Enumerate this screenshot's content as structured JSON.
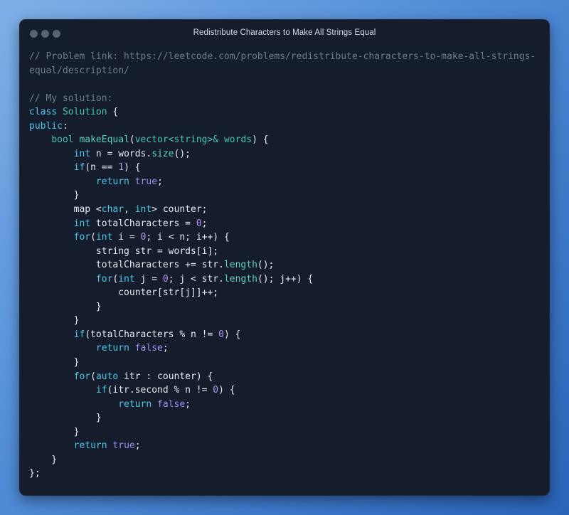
{
  "window": {
    "title": "Redistribute Characters to Make All Strings Equal"
  },
  "code_lines": [
    [
      {
        "t": "// Problem link: https://leetcode.com/problems/redistribute-characters-to-make-all-strings-",
        "c": "com"
      }
    ],
    [
      {
        "t": "equal/description/",
        "c": "com"
      }
    ],
    [],
    [
      {
        "t": "// My solution:",
        "c": "com"
      }
    ],
    [
      {
        "t": "class",
        "c": "kw"
      },
      {
        "t": " ",
        "c": "pl"
      },
      {
        "t": "Solution",
        "c": "ty"
      },
      {
        "t": " {",
        "c": "pl"
      }
    ],
    [
      {
        "t": "public",
        "c": "kw"
      },
      {
        "t": ":",
        "c": "pl"
      }
    ],
    [
      {
        "t": "    ",
        "c": "pl"
      },
      {
        "t": "bool",
        "c": "ty"
      },
      {
        "t": " ",
        "c": "pl"
      },
      {
        "t": "makeEqual",
        "c": "fn"
      },
      {
        "t": "(",
        "c": "pl"
      },
      {
        "t": "vector<string>& words",
        "c": "ty"
      },
      {
        "t": ") {",
        "c": "pl"
      }
    ],
    [
      {
        "t": "        ",
        "c": "pl"
      },
      {
        "t": "int",
        "c": "kw"
      },
      {
        "t": " n = words.",
        "c": "pl"
      },
      {
        "t": "size",
        "c": "fn"
      },
      {
        "t": "();",
        "c": "pl"
      }
    ],
    [
      {
        "t": "        ",
        "c": "pl"
      },
      {
        "t": "if",
        "c": "kw"
      },
      {
        "t": "(n == ",
        "c": "pl"
      },
      {
        "t": "1",
        "c": "num"
      },
      {
        "t": ") {",
        "c": "pl"
      }
    ],
    [
      {
        "t": "            ",
        "c": "pl"
      },
      {
        "t": "return",
        "c": "kw"
      },
      {
        "t": " ",
        "c": "pl"
      },
      {
        "t": "true",
        "c": "lit"
      },
      {
        "t": ";",
        "c": "pl"
      }
    ],
    [
      {
        "t": "        }",
        "c": "pl"
      }
    ],
    [
      {
        "t": "        map <",
        "c": "pl"
      },
      {
        "t": "char",
        "c": "kw"
      },
      {
        "t": ", ",
        "c": "pl"
      },
      {
        "t": "int",
        "c": "kw"
      },
      {
        "t": "> counter;",
        "c": "pl"
      }
    ],
    [
      {
        "t": "        ",
        "c": "pl"
      },
      {
        "t": "int",
        "c": "kw"
      },
      {
        "t": " totalCharacters = ",
        "c": "pl"
      },
      {
        "t": "0",
        "c": "num"
      },
      {
        "t": ";",
        "c": "pl"
      }
    ],
    [
      {
        "t": "        ",
        "c": "pl"
      },
      {
        "t": "for",
        "c": "kw"
      },
      {
        "t": "(",
        "c": "pl"
      },
      {
        "t": "int",
        "c": "kw"
      },
      {
        "t": " i = ",
        "c": "pl"
      },
      {
        "t": "0",
        "c": "num"
      },
      {
        "t": "; i < n; i++) {",
        "c": "pl"
      }
    ],
    [
      {
        "t": "            string str = words[i];",
        "c": "pl"
      }
    ],
    [
      {
        "t": "            totalCharacters += str.",
        "c": "pl"
      },
      {
        "t": "length",
        "c": "fn"
      },
      {
        "t": "();",
        "c": "pl"
      }
    ],
    [
      {
        "t": "            ",
        "c": "pl"
      },
      {
        "t": "for",
        "c": "kw"
      },
      {
        "t": "(",
        "c": "pl"
      },
      {
        "t": "int",
        "c": "kw"
      },
      {
        "t": " j = ",
        "c": "pl"
      },
      {
        "t": "0",
        "c": "num"
      },
      {
        "t": "; j < str.",
        "c": "pl"
      },
      {
        "t": "length",
        "c": "fn"
      },
      {
        "t": "(); j++) {",
        "c": "pl"
      }
    ],
    [
      {
        "t": "                counter[str[j]]++;",
        "c": "pl"
      }
    ],
    [
      {
        "t": "            }",
        "c": "pl"
      }
    ],
    [
      {
        "t": "        }",
        "c": "pl"
      }
    ],
    [
      {
        "t": "        ",
        "c": "pl"
      },
      {
        "t": "if",
        "c": "kw"
      },
      {
        "t": "(totalCharacters % n != ",
        "c": "pl"
      },
      {
        "t": "0",
        "c": "num"
      },
      {
        "t": ") {",
        "c": "pl"
      }
    ],
    [
      {
        "t": "            ",
        "c": "pl"
      },
      {
        "t": "return",
        "c": "kw"
      },
      {
        "t": " ",
        "c": "pl"
      },
      {
        "t": "false",
        "c": "lit"
      },
      {
        "t": ";",
        "c": "pl"
      }
    ],
    [
      {
        "t": "        }",
        "c": "pl"
      }
    ],
    [
      {
        "t": "        ",
        "c": "pl"
      },
      {
        "t": "for",
        "c": "kw"
      },
      {
        "t": "(",
        "c": "pl"
      },
      {
        "t": "auto",
        "c": "kw"
      },
      {
        "t": " itr : counter) {",
        "c": "pl"
      }
    ],
    [
      {
        "t": "            ",
        "c": "pl"
      },
      {
        "t": "if",
        "c": "kw"
      },
      {
        "t": "(itr.second % n != ",
        "c": "pl"
      },
      {
        "t": "0",
        "c": "num"
      },
      {
        "t": ") {",
        "c": "pl"
      }
    ],
    [
      {
        "t": "                ",
        "c": "pl"
      },
      {
        "t": "return",
        "c": "kw"
      },
      {
        "t": " ",
        "c": "pl"
      },
      {
        "t": "false",
        "c": "lit"
      },
      {
        "t": ";",
        "c": "pl"
      }
    ],
    [
      {
        "t": "            }",
        "c": "pl"
      }
    ],
    [
      {
        "t": "        }",
        "c": "pl"
      }
    ],
    [
      {
        "t": "        ",
        "c": "pl"
      },
      {
        "t": "return",
        "c": "kw"
      },
      {
        "t": " ",
        "c": "pl"
      },
      {
        "t": "true",
        "c": "lit"
      },
      {
        "t": ";",
        "c": "pl"
      }
    ],
    [
      {
        "t": "    }",
        "c": "pl"
      }
    ],
    [
      {
        "t": "};",
        "c": "pl"
      }
    ]
  ],
  "colors": {
    "window_bg": "#151d2c",
    "comment": "#707c8c",
    "keyword": "#4fc7e6",
    "type": "#47c4b4",
    "function": "#5fcfc0",
    "number": "#b196f2",
    "literal": "#9d8ef0",
    "plain": "#e6ebf2"
  }
}
